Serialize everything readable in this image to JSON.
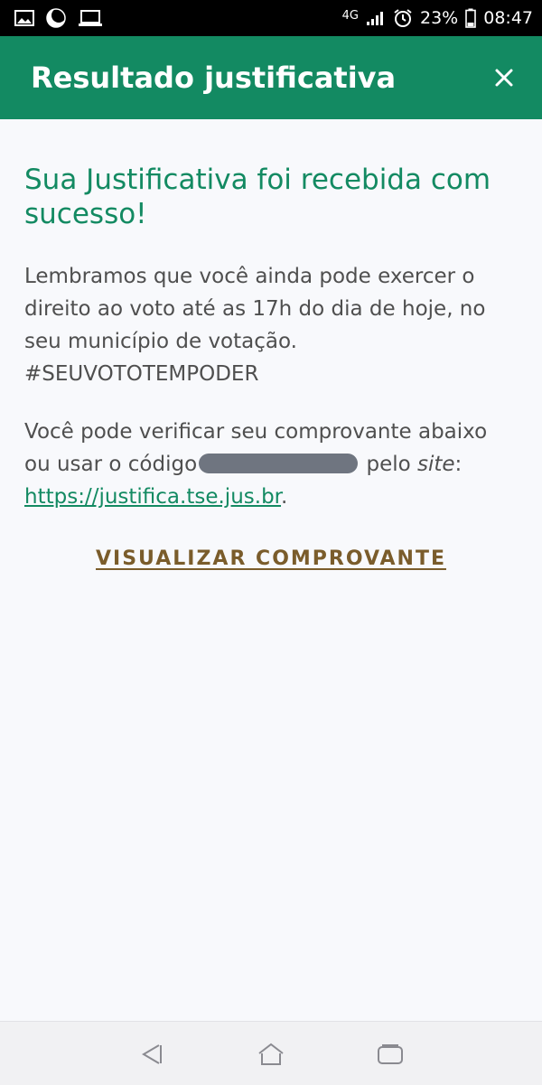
{
  "status_bar": {
    "network": "4G",
    "battery": "23%",
    "time": "08:47",
    "left_icons": [
      "gallery-icon",
      "night-mode-icon",
      "laptop-icon"
    ],
    "right_icons": [
      "signal-icon",
      "alarm-icon",
      "battery-icon"
    ]
  },
  "app_bar": {
    "title": "Resultado justificativa",
    "close_icon": "close-icon",
    "color": "#138a62"
  },
  "content": {
    "heading": "Sua Justificativa foi recebida com sucesso!",
    "paragraph1": "Lembramos que você ainda pode exercer o direito ao voto até as 17h do dia de hoje, no seu município de votação. #SEUVOTOTEMPODER",
    "paragraph2_part1": "Você pode verificar seu comprovante abaixo ou usar o código",
    "paragraph2_part2": " pelo ",
    "paragraph2_site": "site",
    "paragraph2_colon": ": ",
    "link": "https://justifica.tse.jus.br",
    "paragraph2_end": "."
  },
  "action": {
    "label": "VISUALIZAR COMPROVANTE",
    "color": "#7a5c2b"
  },
  "nav_bar": {
    "icons": [
      "back-icon",
      "home-icon",
      "recents-icon"
    ]
  }
}
